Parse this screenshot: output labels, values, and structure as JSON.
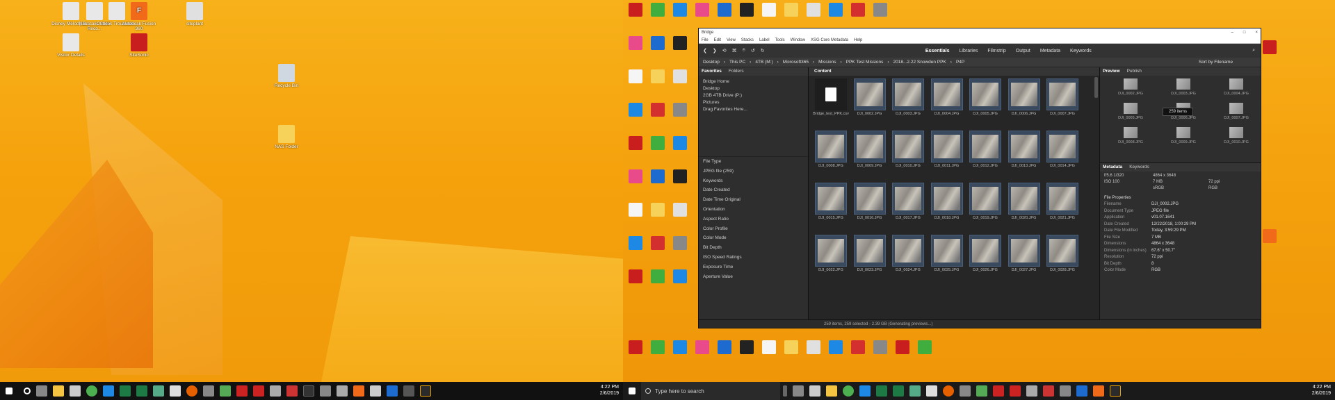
{
  "left_desktop": {
    "icons": [
      {
        "label": "Disney Melody Bl...",
        "color": "#e8e8e8",
        "glyph": ""
      },
      {
        "label": "Nauticalis Suite Reco...",
        "color": "#e8e8e8",
        "glyph": ""
      },
      {
        "label": "Outlook Troublesh...",
        "color": "#e8e8e8",
        "glyph": ""
      },
      {
        "label": "Autodesk Fusion 360",
        "color": "#f06a1a",
        "glyph": "F"
      },
      {
        "label": "siteplant",
        "color": "#e0e0e0",
        "glyph": ""
      },
      {
        "label": "Visitor Details",
        "color": "#e8e8e8",
        "glyph": ""
      },
      {
        "label": "SiteSonic",
        "color": "#c81e1e",
        "glyph": ""
      },
      {
        "label": "Recycle Bin",
        "color": "#cfd8e0",
        "glyph": ""
      },
      {
        "label": "NAS Folder",
        "color": "#f7d25a",
        "glyph": ""
      }
    ],
    "taskbar": {
      "time": "4:22 PM",
      "date": "2/6/2019"
    }
  },
  "right_desktop": {
    "taskbar": {
      "search_placeholder": "Type here to search",
      "time": "4:22 PM",
      "date": "2/6/2019"
    }
  },
  "bridge": {
    "title": "Bridge",
    "menu": [
      "File",
      "Edit",
      "View",
      "Stacks",
      "Label",
      "Tools",
      "Window",
      "XSG Core Metadata",
      "Help"
    ],
    "workspaces": [
      "Essentials",
      "Libraries",
      "Filmstrip",
      "Output",
      "Metadata",
      "Keywords"
    ],
    "active_workspace": "Essentials",
    "breadcrumb": [
      "Desktop",
      "This PC",
      "4TB (M:)",
      "Microsoft365",
      "Missions",
      "PPK Test Missions",
      "2018...2.22 Snowden PPK",
      "P4P"
    ],
    "sort_label": "Sort by Filename",
    "left_tabs": [
      "Favorites",
      "Folders"
    ],
    "favorites": [
      "Bridge Home",
      "Desktop",
      "2GB 4TB Drive (P:)",
      "Pictures",
      "Drag Favorites Here..."
    ],
    "filters": [
      "File Type",
      "JPEG file (259)",
      "Keywords",
      "Date Created",
      "Date Time Original",
      "Orientation",
      "Aspect Ratio",
      "Color Profile",
      "Color Mode",
      "Bit Depth",
      "ISO Speed Ratings",
      "Exposure Time",
      "Aperture Value"
    ],
    "content_tab": "Content",
    "files": [
      "Bridge_test_PPK.csv",
      "DJI_0002.JPG",
      "DJI_0003.JPG",
      "DJI_0004.JPG",
      "DJI_0005.JPG",
      "DJI_0006.JPG",
      "DJI_0007.JPG",
      "DJI_0008.JPG",
      "DJI_0009.JPG",
      "DJI_0010.JPG",
      "DJI_0011.JPG",
      "DJI_0012.JPG",
      "DJI_0013.JPG",
      "DJI_0014.JPG",
      "DJI_0015.JPG",
      "DJI_0016.JPG",
      "DJI_0017.JPG",
      "DJI_0018.JPG",
      "DJI_0019.JPG",
      "DJI_0020.JPG",
      "DJI_0021.JPG",
      "DJI_0022.JPG",
      "DJI_0023.JPG",
      "DJI_0024.JPG",
      "DJI_0025.JPG",
      "DJI_0026.JPG",
      "DJI_0027.JPG",
      "DJI_0028.JPG"
    ],
    "preview_tabs": [
      "Preview",
      "Publish"
    ],
    "preview_files": [
      "DJI_0002.JPG",
      "DJI_0003.JPG",
      "DJI_0004.JPG",
      "DJI_0005.JPG",
      "DJI_0006.JPG",
      "DJI_0007.JPG",
      "DJI_0008.JPG",
      "DJI_0009.JPG",
      "DJI_0010.JPG"
    ],
    "items_badge": "259 items",
    "meta_tabs": [
      "Metadata",
      "Keywords"
    ],
    "meta_summary": {
      "fstop": "f/5.6",
      "shutter": "1/320",
      "dims": "4864 x 3648",
      "size": "7 MB",
      "ppi": "72 ppi",
      "iso": "ISO 100",
      "color": "sRGB",
      "mode": "RGB"
    },
    "file_properties_header": "File Properties",
    "properties": [
      {
        "k": "Filename",
        "v": "DJI_0002.JPG"
      },
      {
        "k": "Document Type",
        "v": "JPEG file"
      },
      {
        "k": "Application",
        "v": "v01.07.1641"
      },
      {
        "k": "Date Created",
        "v": "12/22/2018, 1:00:29 PM"
      },
      {
        "k": "Date File Modified",
        "v": "Today, 3:59:29 PM"
      },
      {
        "k": "File Size",
        "v": "7 MB"
      },
      {
        "k": "Dimensions",
        "v": "4864 x 3648"
      },
      {
        "k": "Dimensions (in inches)",
        "v": "67.6\" x 50.7\""
      },
      {
        "k": "Resolution",
        "v": "72 ppi"
      },
      {
        "k": "Bit Depth",
        "v": "8"
      },
      {
        "k": "Color Mode",
        "v": "RGB"
      }
    ],
    "status": "259 items, 259 selected - 2.39 GB (Generating previews...)"
  }
}
